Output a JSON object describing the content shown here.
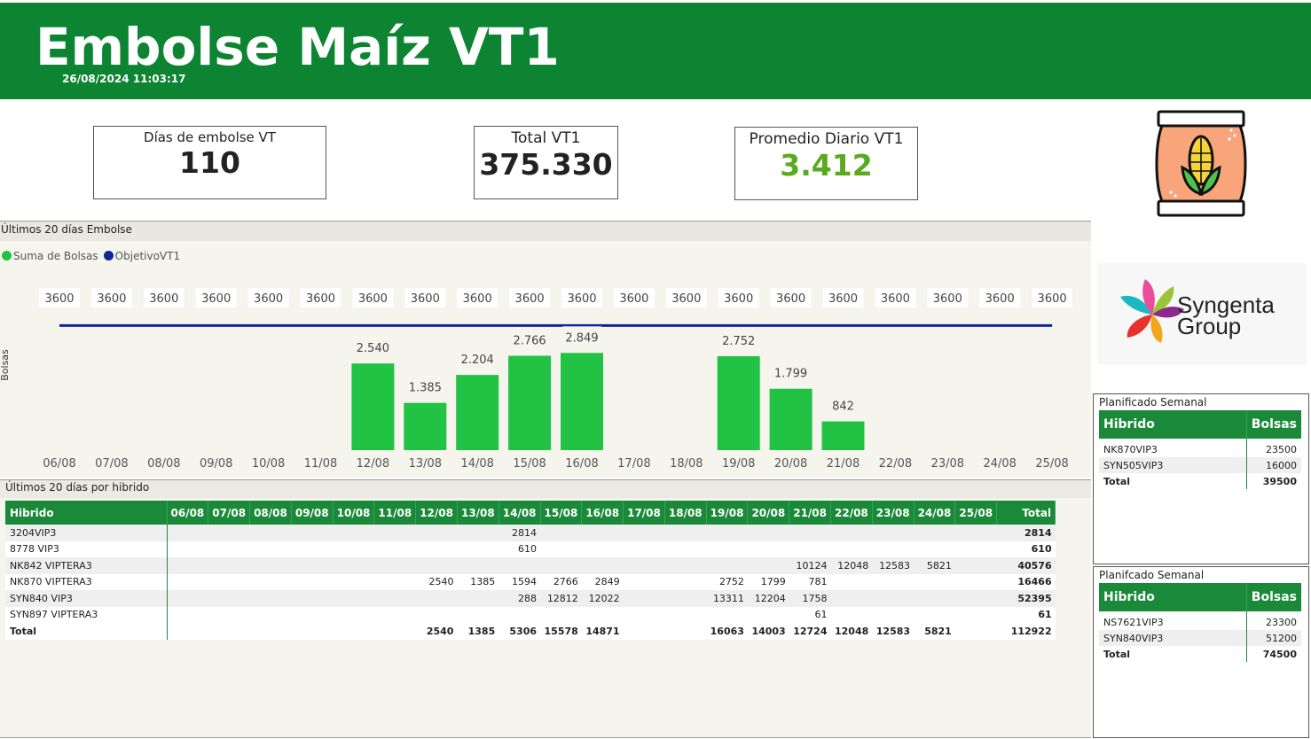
{
  "header": {
    "title": "Embolse Maíz VT1",
    "timestamp": "26/08/2024 11:03:17",
    "background": "#0c8432"
  },
  "kpis": {
    "dias": {
      "label": "Días de embolse VT",
      "value": "110"
    },
    "total": {
      "label": "Total VT1",
      "value": "375.330"
    },
    "promedio": {
      "label": "Promedio Diario VT1",
      "value": "3.412",
      "color": "#5aaa1e"
    }
  },
  "logos": {
    "syngenta_line1": "Syngenta",
    "syngenta_line2": "Group",
    "seed_bag_icon": "corn-seed-bag-icon"
  },
  "chart": {
    "panel_title": "Últimos 20 días Embolse",
    "legend": [
      {
        "name": "Suma de Bolsas",
        "color": "#22c244"
      },
      {
        "name": "ObjetivoVT1",
        "color": "#10269a"
      }
    ],
    "ylabel": "Bolsas"
  },
  "chart_data": {
    "type": "bar",
    "categories": [
      "06/08",
      "07/08",
      "08/08",
      "09/08",
      "10/08",
      "11/08",
      "12/08",
      "13/08",
      "14/08",
      "15/08",
      "16/08",
      "17/08",
      "18/08",
      "19/08",
      "20/08",
      "21/08",
      "22/08",
      "23/08",
      "24/08",
      "25/08"
    ],
    "series": [
      {
        "name": "Suma de Bolsas",
        "type": "bar",
        "color": "#22c244",
        "values": [
          null,
          null,
          null,
          null,
          null,
          null,
          2540,
          1385,
          2204,
          2766,
          2849,
          null,
          null,
          2752,
          1799,
          842,
          null,
          null,
          null,
          null
        ],
        "labels": [
          "",
          "",
          "",
          "",
          "",
          "",
          "2.540",
          "1.385",
          "2.204",
          "2.766",
          "2.849",
          "",
          "",
          "2.752",
          "1.799",
          "842",
          "",
          "",
          "",
          ""
        ]
      },
      {
        "name": "ObjetivoVT1",
        "type": "line",
        "color": "#10269a",
        "values": [
          3600,
          3600,
          3600,
          3600,
          3600,
          3600,
          3600,
          3600,
          3600,
          3600,
          3600,
          3600,
          3600,
          3600,
          3600,
          3600,
          3600,
          3600,
          3600,
          3600
        ],
        "labels": [
          "3600",
          "3600",
          "3600",
          "3600",
          "3600",
          "3600",
          "3600",
          "3600",
          "3600",
          "3600",
          "3600",
          "3600",
          "3600",
          "3600",
          "3600",
          "3600",
          "3600",
          "3600",
          "3600",
          "3600"
        ]
      }
    ],
    "ylabel": "Bolsas",
    "ylim": [
      0,
      3700
    ]
  },
  "matrix": {
    "panel_title": "Últimos 20 días por hibrido",
    "columns": [
      "Hibrido",
      "06/08",
      "07/08",
      "08/08",
      "09/08",
      "10/08",
      "11/08",
      "12/08",
      "13/08",
      "14/08",
      "15/08",
      "16/08",
      "17/08",
      "18/08",
      "19/08",
      "20/08",
      "21/08",
      "22/08",
      "23/08",
      "24/08",
      "25/08",
      "Total"
    ],
    "rows": [
      [
        "3204VIP3",
        "",
        "",
        "",
        "",
        "",
        "",
        "",
        "",
        "2814",
        "",
        "",
        "",
        "",
        "",
        "",
        "",
        "",
        "",
        "",
        "",
        "2814"
      ],
      [
        "8778 VIP3",
        "",
        "",
        "",
        "",
        "",
        "",
        "",
        "",
        "610",
        "",
        "",
        "",
        "",
        "",
        "",
        "",
        "",
        "",
        "",
        "",
        "610"
      ],
      [
        "NK842 VIPTERA3",
        "",
        "",
        "",
        "",
        "",
        "",
        "",
        "",
        "",
        "",
        "",
        "",
        "",
        "",
        "",
        "10124",
        "12048",
        "12583",
        "5821",
        "",
        "40576"
      ],
      [
        "NK870 VIPTERA3",
        "",
        "",
        "",
        "",
        "",
        "",
        "2540",
        "1385",
        "1594",
        "2766",
        "2849",
        "",
        "",
        "2752",
        "1799",
        "781",
        "",
        "",
        "",
        "",
        "16466"
      ],
      [
        "SYN840 VIP3",
        "",
        "",
        "",
        "",
        "",
        "",
        "",
        "",
        "288",
        "12812",
        "12022",
        "",
        "",
        "13311",
        "12204",
        "1758",
        "",
        "",
        "",
        "",
        "52395"
      ],
      [
        "SYN897 VIPTERA3",
        "",
        "",
        "",
        "",
        "",
        "",
        "",
        "",
        "",
        "",
        "",
        "",
        "",
        "",
        "",
        "61",
        "",
        "",
        "",
        "",
        "61"
      ],
      [
        "Total",
        "",
        "",
        "",
        "",
        "",
        "",
        "2540",
        "1385",
        "5306",
        "15578",
        "14871",
        "",
        "",
        "16063",
        "14003",
        "12724",
        "12048",
        "12583",
        "5821",
        "",
        "112922"
      ]
    ]
  },
  "plan1": {
    "title": "Planificado Semanal",
    "headers": [
      "Hibrido",
      "Bolsas"
    ],
    "rows": [
      [
        "NK870VIP3",
        "23500"
      ],
      [
        "SYN505VIP3",
        "16000"
      ]
    ],
    "total": [
      "Total",
      "39500"
    ]
  },
  "plan2": {
    "title": "Planifcado Semanal",
    "headers": [
      "Hibrido",
      "Bolsas"
    ],
    "rows": [
      [
        "NS7621VIP3",
        "23300"
      ],
      [
        "SYN840VIP3",
        "51200"
      ]
    ],
    "total": [
      "Total",
      "74500"
    ]
  }
}
